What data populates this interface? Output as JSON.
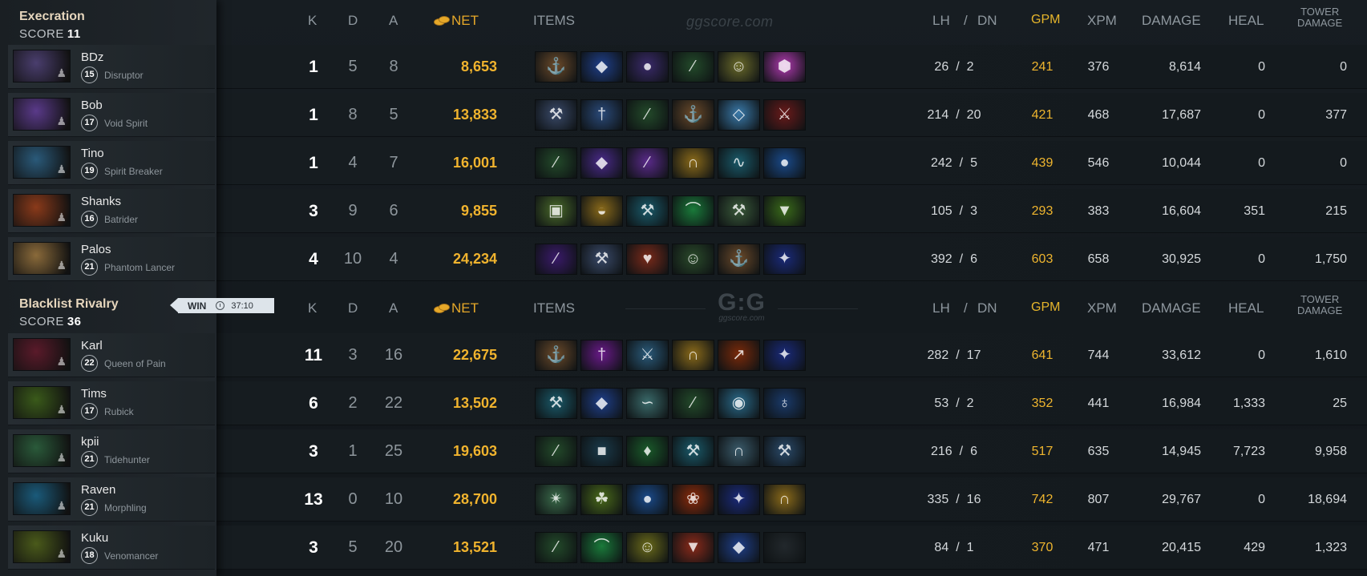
{
  "teams": [
    {
      "name": "Execration",
      "score_label": "SCORE",
      "score": "11",
      "players": [
        {
          "name": "BDz",
          "level": "15",
          "hero": "Disruptor",
          "portrait_color": "#4a3e6e",
          "k": "1",
          "d": "5",
          "a": "8",
          "net": "8,653",
          "lh": "26",
          "dn": "2",
          "gpm": "241",
          "xpm": "376",
          "damage": "8,614",
          "heal": "0",
          "tower": "0",
          "items": [
            {
              "icon": "boots-icon",
              "color": "#6b4a2a"
            },
            {
              "icon": "cloak-icon",
              "color": "#1f3f8a"
            },
            {
              "icon": "orb-icon",
              "color": "#3a2a6a"
            },
            {
              "icon": "wand-icon",
              "color": "#234a2a"
            },
            {
              "icon": "mask-icon",
              "color": "#6a6a2a"
            },
            {
              "icon": "crystal-icon",
              "color": "#b03ab0"
            }
          ]
        },
        {
          "name": "Bob",
          "level": "17",
          "hero": "Void Spirit",
          "portrait_color": "#5a3a8a",
          "k": "1",
          "d": "8",
          "a": "5",
          "net": "13,833",
          "lh": "214",
          "dn": "20",
          "gpm": "421",
          "xpm": "468",
          "damage": "17,687",
          "heal": "0",
          "tower": "377",
          "items": [
            {
              "icon": "axe-icon",
              "color": "#3a4a6a"
            },
            {
              "icon": "staff-icon",
              "color": "#2a4a7a"
            },
            {
              "icon": "wand-icon",
              "color": "#234a2a"
            },
            {
              "icon": "boots-icon",
              "color": "#6b4a2a"
            },
            {
              "icon": "gem-icon",
              "color": "#3a7aaa"
            },
            {
              "icon": "sword-icon",
              "color": "#6a1a1a"
            }
          ]
        },
        {
          "name": "Tino",
          "level": "19",
          "hero": "Spirit Breaker",
          "portrait_color": "#2a5a7a",
          "k": "1",
          "d": "4",
          "a": "7",
          "net": "16,001",
          "lh": "242",
          "dn": "5",
          "gpm": "439",
          "xpm": "546",
          "damage": "10,044",
          "heal": "0",
          "tower": "0",
          "items": [
            {
              "icon": "wand-icon",
              "color": "#234a2a"
            },
            {
              "icon": "cloak-icon",
              "color": "#4a2a8a"
            },
            {
              "icon": "blade-icon",
              "color": "#5a2a8a"
            },
            {
              "icon": "helm-icon",
              "color": "#8a6a1a"
            },
            {
              "icon": "wave-icon",
              "color": "#1a5a6a"
            },
            {
              "icon": "orb-icon",
              "color": "#1a4a8a"
            }
          ]
        },
        {
          "name": "Shanks",
          "level": "16",
          "hero": "Batrider",
          "portrait_color": "#8a3a1a",
          "k": "3",
          "d": "9",
          "a": "6",
          "net": "9,855",
          "lh": "105",
          "dn": "3",
          "gpm": "293",
          "xpm": "383",
          "damage": "16,604",
          "heal": "351",
          "tower": "215",
          "items": [
            {
              "icon": "bracer-icon",
              "color": "#4a6a2a"
            },
            {
              "icon": "pouch-icon",
              "color": "#8a6a1a"
            },
            {
              "icon": "axe-icon",
              "color": "#1a5a6a"
            },
            {
              "icon": "slipper-icon",
              "color": "#1a7a3a"
            },
            {
              "icon": "hammer-icon",
              "color": "#3a5a3a"
            },
            {
              "icon": "shield-icon",
              "color": "#3a6a1a"
            }
          ]
        },
        {
          "name": "Palos",
          "level": "21",
          "hero": "Phantom Lancer",
          "portrait_color": "#8a6a3a",
          "k": "4",
          "d": "10",
          "a": "4",
          "net": "24,234",
          "lh": "392",
          "dn": "6",
          "gpm": "603",
          "xpm": "658",
          "damage": "30,925",
          "heal": "0",
          "tower": "1,750",
          "items": [
            {
              "icon": "blade-icon",
              "color": "#3a1a6a"
            },
            {
              "icon": "axe-icon",
              "color": "#3a4a6a"
            },
            {
              "icon": "heart-icon",
              "color": "#7a2a1a"
            },
            {
              "icon": "mask-icon",
              "color": "#2a4a2a"
            },
            {
              "icon": "boots-icon",
              "color": "#6b4a2a"
            },
            {
              "icon": "scepter-icon",
              "color": "#1a2a7a"
            }
          ]
        }
      ]
    },
    {
      "name": "Blacklist Rivalry",
      "score_label": "SCORE",
      "score": "36",
      "players": [
        {
          "name": "Karl",
          "level": "22",
          "hero": "Queen of Pain",
          "portrait_color": "#5a1a2a",
          "k": "11",
          "d": "3",
          "a": "16",
          "net": "22,675",
          "lh": "282",
          "dn": "17",
          "gpm": "641",
          "xpm": "744",
          "damage": "33,612",
          "heal": "0",
          "tower": "1,610",
          "items": [
            {
              "icon": "boots-icon",
              "color": "#6b4a2a"
            },
            {
              "icon": "dagger-icon",
              "color": "#6a1a8a"
            },
            {
              "icon": "sword-icon",
              "color": "#2a5a7a"
            },
            {
              "icon": "helm-icon",
              "color": "#8a6a1a"
            },
            {
              "icon": "spear-icon",
              "color": "#7a2a0a"
            },
            {
              "icon": "scepter-icon",
              "color": "#1a2a7a"
            }
          ]
        },
        {
          "name": "Tims",
          "level": "17",
          "hero": "Rubick",
          "portrait_color": "#3a5a1a",
          "k": "6",
          "d": "2",
          "a": "22",
          "net": "13,502",
          "lh": "53",
          "dn": "2",
          "gpm": "352",
          "xpm": "441",
          "damage": "16,984",
          "heal": "1,333",
          "tower": "25",
          "items": [
            {
              "icon": "axe-icon",
              "color": "#1a5a6a"
            },
            {
              "icon": "cloak-icon",
              "color": "#1f3f8a"
            },
            {
              "icon": "wind-icon",
              "color": "#3a6a6a"
            },
            {
              "icon": "wand-icon",
              "color": "#234a2a"
            },
            {
              "icon": "globe-icon",
              "color": "#2a6a8a"
            },
            {
              "icon": "potion-icon",
              "color": "#1a3a6a"
            }
          ]
        },
        {
          "name": "kpii",
          "level": "21",
          "hero": "Tidehunter",
          "portrait_color": "#2a5a3a",
          "k": "3",
          "d": "1",
          "a": "25",
          "net": "19,603",
          "lh": "216",
          "dn": "6",
          "gpm": "517",
          "xpm": "635",
          "damage": "14,945",
          "heal": "7,723",
          "tower": "9,958",
          "items": [
            {
              "icon": "wand-icon",
              "color": "#234a2a"
            },
            {
              "icon": "armor-icon",
              "color": "#1a3a4a"
            },
            {
              "icon": "emerald-icon",
              "color": "#1a5a2a"
            },
            {
              "icon": "axe-icon",
              "color": "#1a5a6a"
            },
            {
              "icon": "helm-icon",
              "color": "#3a5a6a"
            },
            {
              "icon": "hammer-icon",
              "color": "#2a4a6a"
            }
          ]
        },
        {
          "name": "Raven",
          "level": "21",
          "hero": "Morphling",
          "portrait_color": "#1a5a7a",
          "k": "13",
          "d": "0",
          "a": "10",
          "net": "28,700",
          "lh": "335",
          "dn": "16",
          "gpm": "742",
          "xpm": "807",
          "damage": "29,767",
          "heal": "0",
          "tower": "18,694",
          "items": [
            {
              "icon": "claw-icon",
              "color": "#3a6a4a"
            },
            {
              "icon": "leaf-icon",
              "color": "#4a6a1a"
            },
            {
              "icon": "orb-icon",
              "color": "#1a4a8a"
            },
            {
              "icon": "flame-icon",
              "color": "#8a2a0a"
            },
            {
              "icon": "scepter-icon",
              "color": "#1a2a7a"
            },
            {
              "icon": "helm-icon",
              "color": "#8a6a1a"
            }
          ]
        },
        {
          "name": "Kuku",
          "level": "18",
          "hero": "Venomancer",
          "portrait_color": "#4a5a1a",
          "k": "3",
          "d": "5",
          "a": "20",
          "net": "13,521",
          "lh": "84",
          "dn": "1",
          "gpm": "370",
          "xpm": "471",
          "damage": "20,415",
          "heal": "429",
          "tower": "1,323",
          "items": [
            {
              "icon": "wand-icon",
              "color": "#234a2a"
            },
            {
              "icon": "slipper-icon",
              "color": "#1a7a3a"
            },
            {
              "icon": "mask-icon",
              "color": "#6a6a1a"
            },
            {
              "icon": "shield-icon",
              "color": "#8a2a1a"
            },
            {
              "icon": "cloak-icon",
              "color": "#1f3f8a"
            },
            {
              "icon": "empty-slot",
              "color": "#22282c"
            }
          ]
        }
      ]
    }
  ],
  "columns": {
    "k": "K",
    "d": "D",
    "a": "A",
    "net": "NET",
    "items": "ITEMS",
    "lh": "LH",
    "sep": "/",
    "dn": "DN",
    "gpm": "GPM",
    "xpm": "XPM",
    "damage": "DAMAGE",
    "heal": "HEAL",
    "tower_line1": "TOWER",
    "tower_line2": "DAMAGE"
  },
  "watermark": "ggscore.com",
  "logo": {
    "big": "G:G",
    "small": "ggscore.com"
  },
  "result": {
    "label": "WIN",
    "duration": "37:10"
  }
}
